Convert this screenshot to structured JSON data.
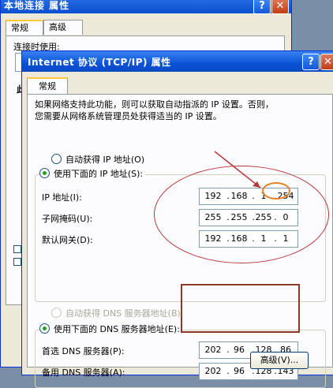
{
  "back_window": {
    "title": "本地连接 属性",
    "tabs": [
      "常规",
      "高级"
    ],
    "connect_label": "连接时使用:",
    "side_fragment": "此"
  },
  "front_window": {
    "title": "Internet 协议 (TCP/IP) 属性",
    "tab": "常规",
    "intro_line1": "如果网络支持此功能，则可以获取自动指派的 IP 设置。否则，",
    "intro_line2": "您需要从网络系统管理员处获得适当的 IP 设置。",
    "ip_group": {
      "auto_ip_label": "自动获得 IP 地址(O)",
      "manual_ip_label": "使用下面的 IP 地址(S):",
      "fields": [
        {
          "label": "IP 地址(I):",
          "octets": [
            "192",
            "168",
            "1",
            "254"
          ]
        },
        {
          "label": "子网掩码(U):",
          "octets": [
            "255",
            "255",
            "255",
            "0"
          ]
        },
        {
          "label": "默认网关(D):",
          "octets": [
            "192",
            "168",
            "1",
            "1"
          ]
        }
      ]
    },
    "dns_group": {
      "auto_dns_label": "自动获得 DNS 服务器地址(B)",
      "manual_dns_label": "使用下面的 DNS 服务器地址(E):",
      "fields": [
        {
          "label": "首选 DNS 服务器(P):",
          "octets": [
            "202",
            "96",
            "128",
            "86"
          ]
        },
        {
          "label": "备用 DNS 服务器(A):",
          "octets": [
            "202",
            "96",
            "128",
            "143"
          ]
        }
      ]
    },
    "advanced_button": "高级(V)..."
  },
  "titlebar_buttons": {
    "help": "?",
    "close": "✕"
  },
  "colors": {
    "titlebar": "#0a52d8",
    "annotation_red": "#b43a3a",
    "annotation_orange": "#e67e22",
    "annotation_box": "#8b3a2a"
  }
}
